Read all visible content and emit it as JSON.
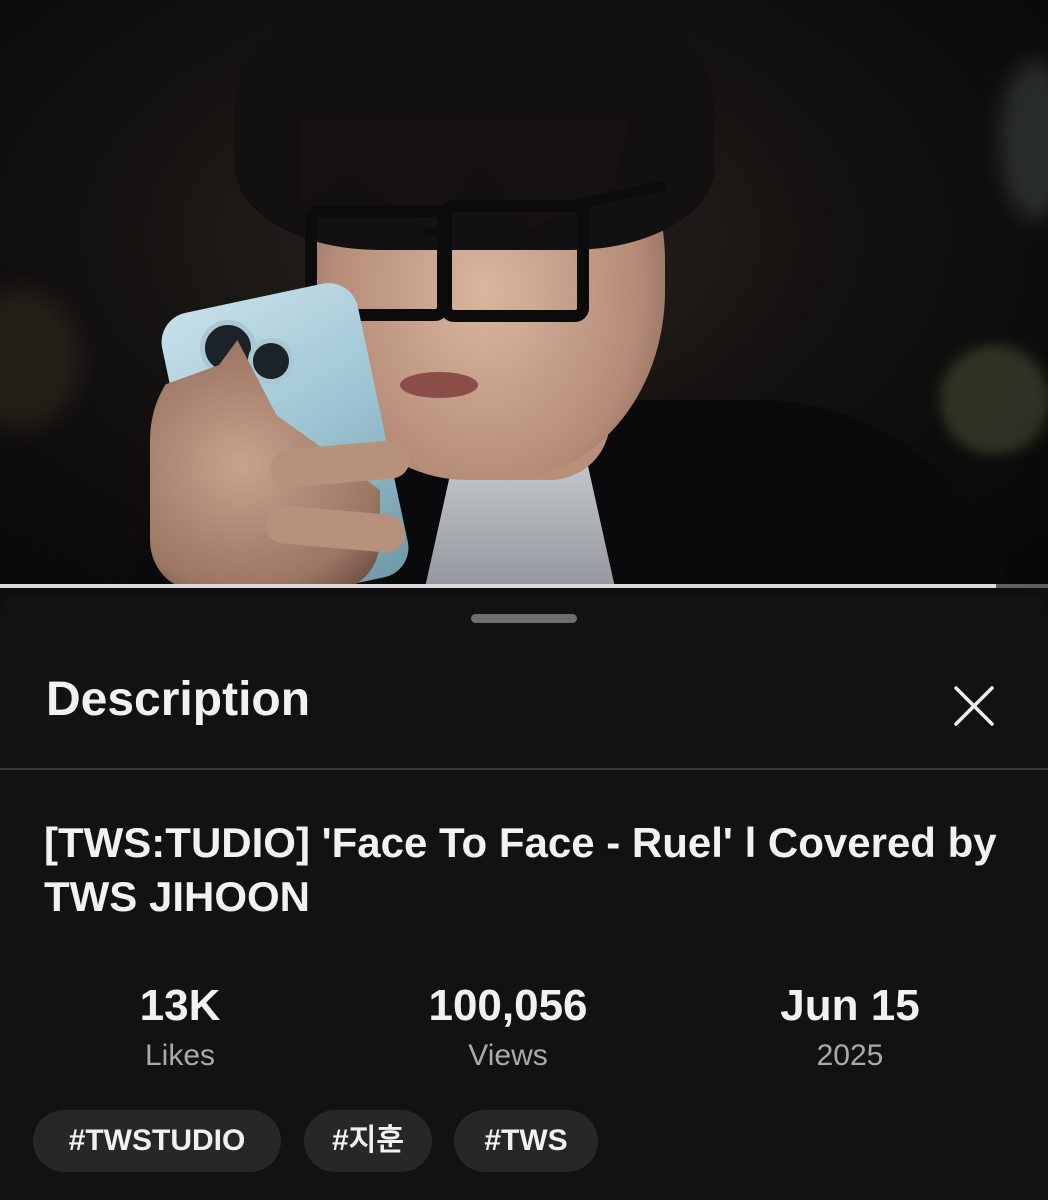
{
  "player": {
    "progress_fraction": 0.95
  },
  "sheet": {
    "title": "Description",
    "close_icon": "close-icon"
  },
  "video": {
    "title": "[TWS:TUDIO] 'Face To Face - Ruel' l Covered by TWS JIHOON"
  },
  "stats": {
    "likes": {
      "value": "13K",
      "label": "Likes"
    },
    "views": {
      "value": "100,056",
      "label": "Views"
    },
    "date": {
      "value": "Jun 15",
      "label": "2025"
    }
  },
  "tags": [
    "#TWSTUDIO",
    "#지훈",
    "#TWS"
  ]
}
